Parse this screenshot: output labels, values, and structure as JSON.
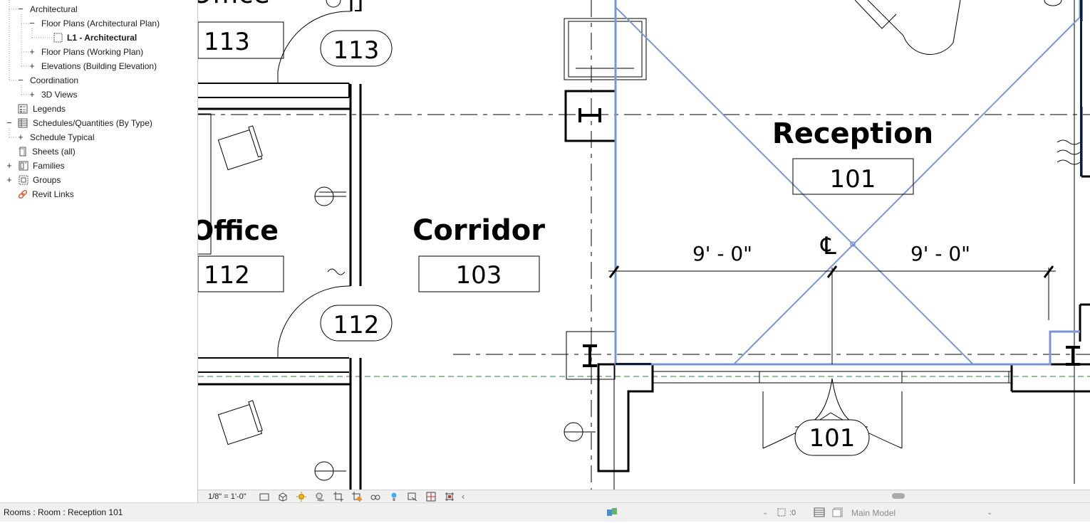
{
  "project_browser": {
    "items": [
      {
        "label": "Architectural",
        "toggle": "−",
        "icon": ""
      },
      {
        "label": "Floor Plans (Architectural Plan)",
        "toggle": "−",
        "icon": ""
      },
      {
        "label": "L1 - Architectural",
        "toggle": "",
        "icon": "floor-plan-icon"
      },
      {
        "label": "Floor Plans (Working Plan)",
        "toggle": "+",
        "icon": ""
      },
      {
        "label": "Elevations (Building Elevation)",
        "toggle": "+",
        "icon": ""
      },
      {
        "label": "Coordination",
        "toggle": "−",
        "icon": ""
      },
      {
        "label": "3D Views",
        "toggle": "+",
        "icon": ""
      },
      {
        "label": "Legends",
        "toggle": "",
        "icon": "legend-icon"
      },
      {
        "label": "Schedules/Quantities (By Type)",
        "toggle": "−",
        "icon": "schedule-icon"
      },
      {
        "label": "Schedule Typical",
        "toggle": "+",
        "icon": ""
      },
      {
        "label": "Sheets (all)",
        "toggle": "",
        "icon": "sheets-icon"
      },
      {
        "label": "Families",
        "toggle": "+",
        "icon": "families-icon"
      },
      {
        "label": "Groups",
        "toggle": "+",
        "icon": "groups-icon"
      },
      {
        "label": "Revit Links",
        "toggle": "",
        "icon": "link-icon"
      }
    ]
  },
  "plan": {
    "rooms": [
      {
        "name": "Office",
        "number": "113",
        "tag": "113"
      },
      {
        "name": "Office",
        "number": "112",
        "tag": "112"
      },
      {
        "name": "Corridor",
        "number": "103"
      },
      {
        "name": "Reception",
        "number": "101",
        "tag": "101"
      }
    ],
    "dimensions": [
      "9' - 0\"",
      "9' - 0\""
    ],
    "centerline_symbol": "℄",
    "colors": {
      "selection": "#7b96d4",
      "walls": "#000000",
      "level_line": "#2e7d32"
    }
  },
  "view_control": {
    "scale": "1/8\" = 1'-0\""
  },
  "status_bar": {
    "text": "Rooms : Room : Reception 101",
    "selection_count": ":0",
    "model": "Main Model"
  }
}
